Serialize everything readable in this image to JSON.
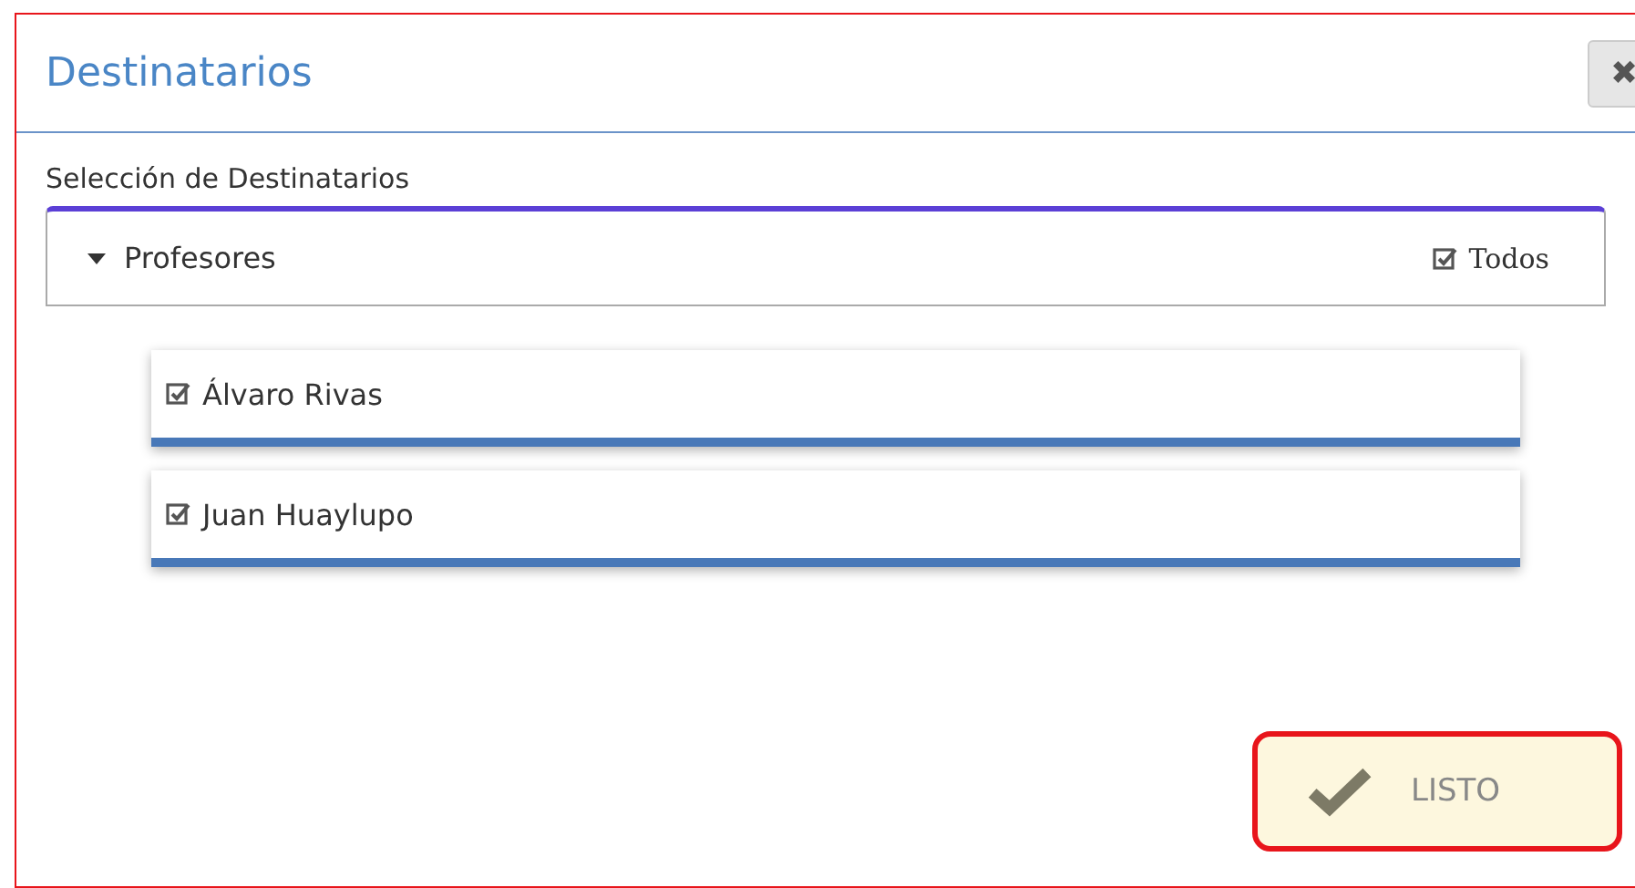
{
  "dialog": {
    "title": "Destinatarios",
    "close_label": "✖"
  },
  "section_label": "Selección de Destinatarios",
  "group": {
    "name": "Profesores",
    "expanded": true,
    "all_label": "Todos",
    "all_checked": true,
    "children": [
      {
        "name": "Álvaro Rivas",
        "checked": true
      },
      {
        "name": "Juan Huaylupo",
        "checked": true
      }
    ]
  },
  "confirm_button": "LISTO"
}
